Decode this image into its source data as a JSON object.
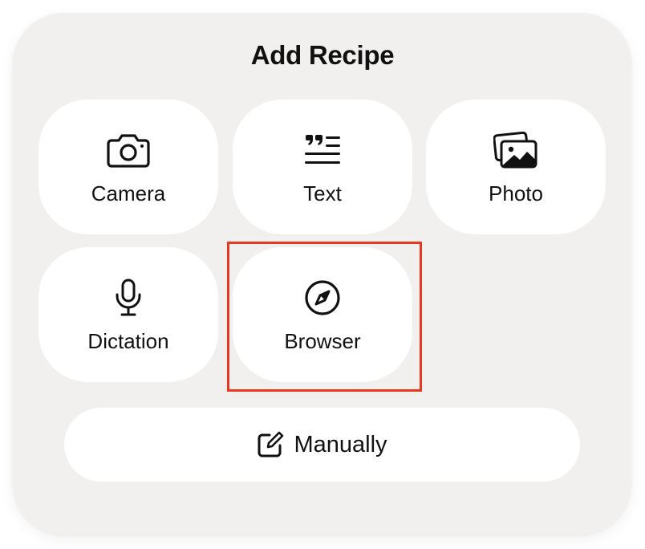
{
  "sheet": {
    "title": "Add Recipe"
  },
  "options": [
    {
      "id": "camera",
      "label": "Camera",
      "icon": "camera-icon"
    },
    {
      "id": "text",
      "label": "Text",
      "icon": "text-quote-icon"
    },
    {
      "id": "photo",
      "label": "Photo",
      "icon": "photo-library-icon"
    },
    {
      "id": "dictation",
      "label": "Dictation",
      "icon": "microphone-icon"
    },
    {
      "id": "browser",
      "label": "Browser",
      "icon": "compass-icon"
    }
  ],
  "manual": {
    "label": "Manually",
    "icon": "compose-icon"
  },
  "colors": {
    "sheet_background": "#f1f0ee",
    "tile_background": "#ffffff",
    "text": "#111111",
    "highlight": "#e8381f"
  }
}
